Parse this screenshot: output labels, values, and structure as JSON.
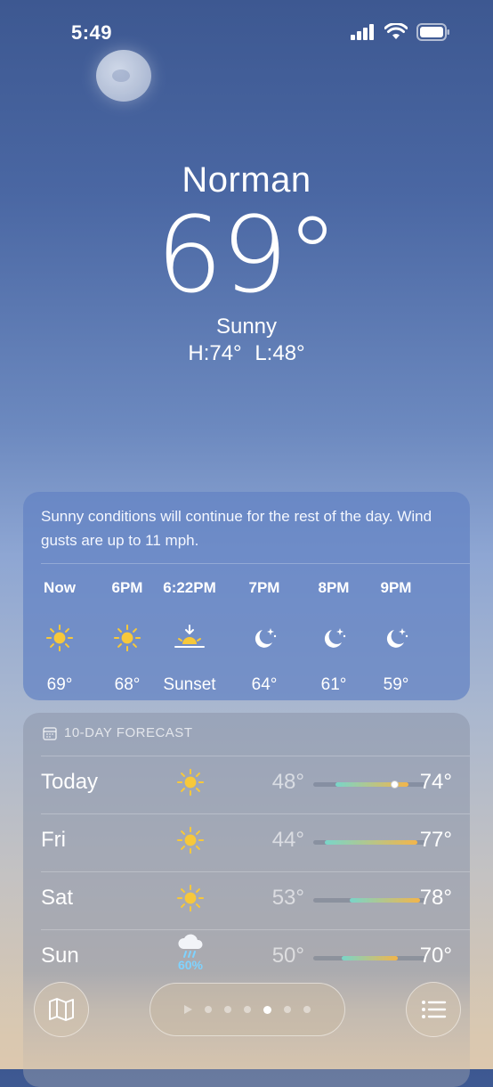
{
  "status": {
    "time": "5:49"
  },
  "location": {
    "city": "Norman",
    "temperature": "69°",
    "condition": "Sunny",
    "high": "H:74°",
    "low": "L:48°"
  },
  "hourly": {
    "summary": "Sunny conditions will continue for the rest of the day. Wind gusts are up to 11 mph.",
    "items": [
      {
        "time": "Now",
        "icon": "sun-icon",
        "temp": "69°"
      },
      {
        "time": "6PM",
        "icon": "sun-icon",
        "temp": "68°"
      },
      {
        "time": "6:22PM",
        "icon": "sunset-icon",
        "temp": "Sunset"
      },
      {
        "time": "7PM",
        "icon": "moon-stars-icon",
        "temp": "64°"
      },
      {
        "time": "8PM",
        "icon": "moon-stars-icon",
        "temp": "61°"
      },
      {
        "time": "9PM",
        "icon": "moon-stars-icon",
        "temp": "59°"
      }
    ]
  },
  "forecast": {
    "header": "10-DAY FORECAST",
    "range": [
      40,
      80
    ],
    "days": [
      {
        "day": "Today",
        "icon": "sun-icon",
        "precip": "",
        "low": "48°",
        "high": "74°",
        "low_value": 48,
        "high_value": 74,
        "current": 69
      },
      {
        "day": "Fri",
        "icon": "sun-icon",
        "precip": "",
        "low": "44°",
        "high": "77°",
        "low_value": 44,
        "high_value": 77
      },
      {
        "day": "Sat",
        "icon": "sun-icon",
        "precip": "",
        "low": "53°",
        "high": "78°",
        "low_value": 53,
        "high_value": 78
      },
      {
        "day": "Sun",
        "icon": "rain-cloud-icon",
        "precip": "60%",
        "low": "50°",
        "high": "70°",
        "low_value": 50,
        "high_value": 70
      }
    ]
  },
  "colors": {
    "sun": "#f7c83a",
    "precip": "#7fd3ff",
    "bar_cool": "#79d5c9",
    "bar_warm": "#f3b54a"
  }
}
